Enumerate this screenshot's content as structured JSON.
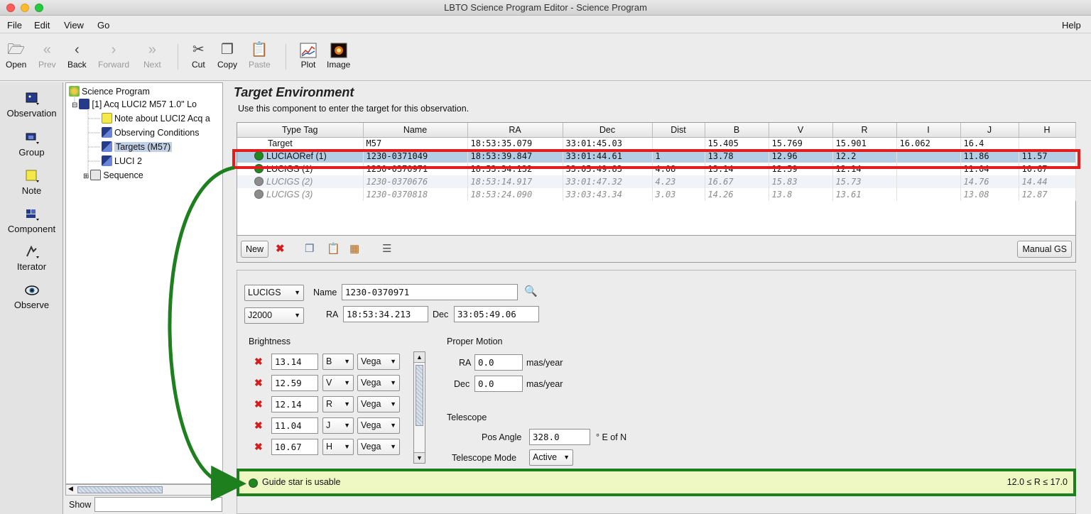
{
  "window": {
    "title": "LBTO Science Program Editor - Science Program"
  },
  "menu": {
    "file": "File",
    "edit": "Edit",
    "view": "View",
    "go": "Go",
    "help": "Help"
  },
  "toolbar": {
    "open": "Open",
    "prev": "Prev",
    "back": "Back",
    "forward": "Forward",
    "next": "Next",
    "cut": "Cut",
    "copy": "Copy",
    "paste": "Paste",
    "plot": "Plot",
    "image": "Image"
  },
  "palette": {
    "observation": "Observation",
    "group": "Group",
    "note": "Note",
    "component": "Component",
    "iterator": "Iterator",
    "observe": "Observe"
  },
  "tree": {
    "root": "Science Program",
    "obs": "[1] Acq LUCI2 M57 1.0\" Lo",
    "note": "Note about LUCI2 Acq a",
    "conditions": "Observing Conditions",
    "targets": "Targets (M57)",
    "luci": "LUCI 2",
    "sequence": "Sequence"
  },
  "show": {
    "label": "Show"
  },
  "panel": {
    "title": "Target Environment",
    "description": "Use this component to enter the target for this observation."
  },
  "table": {
    "headers": [
      "Type Tag",
      "Name",
      "RA",
      "Dec",
      "Dist",
      "B",
      "V",
      "R",
      "I",
      "J",
      "H"
    ],
    "rows": [
      [
        "Target",
        "M57",
        "18:53:35.079",
        "33:01:45.03",
        "",
        "15.405",
        "15.769",
        "15.901",
        "16.062",
        "16.4",
        ""
      ],
      [
        "LUCIAORef (1)",
        "1230-0371049",
        "18:53:39.847",
        "33:01:44.61",
        "1",
        "13.78",
        "12.96",
        "12.2",
        "",
        "11.86",
        "11.57"
      ],
      [
        "LUCIGS (1)",
        "1230-0370971",
        "18:53:34.132",
        "33:05:49.83",
        "4.08",
        "13.14",
        "12.59",
        "12.14",
        "",
        "11.04",
        "10.67"
      ],
      [
        "LUCIGS (2)",
        "1230-0370676",
        "18:53:14.917",
        "33:01:47.32",
        "4.23",
        "16.67",
        "15.83",
        "15.73",
        "",
        "14.76",
        "14.44"
      ],
      [
        "LUCIGS (3)",
        "1230-0370818",
        "18:53:24.090",
        "33:03:43.34",
        "3.03",
        "14.26",
        "13.8",
        "13.61",
        "",
        "13.08",
        "12.87"
      ]
    ]
  },
  "table_tools": {
    "new": "New",
    "manual_gs": "Manual GS"
  },
  "detail": {
    "tag": "LUCIGS",
    "name_label": "Name",
    "name_value": "1230-0370971",
    "system": "J2000",
    "ra_label": "RA",
    "ra_value": "18:53:34.213",
    "dec_label": "Dec",
    "dec_value": "33:05:49.06",
    "brightness_label": "Brightness",
    "brightness": [
      {
        "value": "13.14",
        "band": "B",
        "system": "Vega"
      },
      {
        "value": "12.59",
        "band": "V",
        "system": "Vega"
      },
      {
        "value": "12.14",
        "band": "R",
        "system": "Vega"
      },
      {
        "value": "11.04",
        "band": "J",
        "system": "Vega"
      },
      {
        "value": "10.67",
        "band": "H",
        "system": "Vega"
      }
    ],
    "pm_label": "Proper Motion",
    "pm_ra_label": "RA",
    "pm_ra_value": "0.0",
    "pm_dec_label": "Dec",
    "pm_dec_value": "0.0",
    "pm_unit": "mas/year",
    "telescope_label": "Telescope",
    "pos_angle_label": "Pos Angle",
    "pos_angle_value": "328.0",
    "pos_angle_unit": "° E of N",
    "tel_mode_label": "Telescope Mode",
    "tel_mode_value": "Active"
  },
  "status": {
    "message": "Guide star is usable",
    "range": "12.0 ≤ R ≤ 17.0"
  },
  "colors": {
    "highlight_red": "#e51c1c",
    "highlight_green": "#1e7f1e",
    "selection": "#b3cde5"
  }
}
